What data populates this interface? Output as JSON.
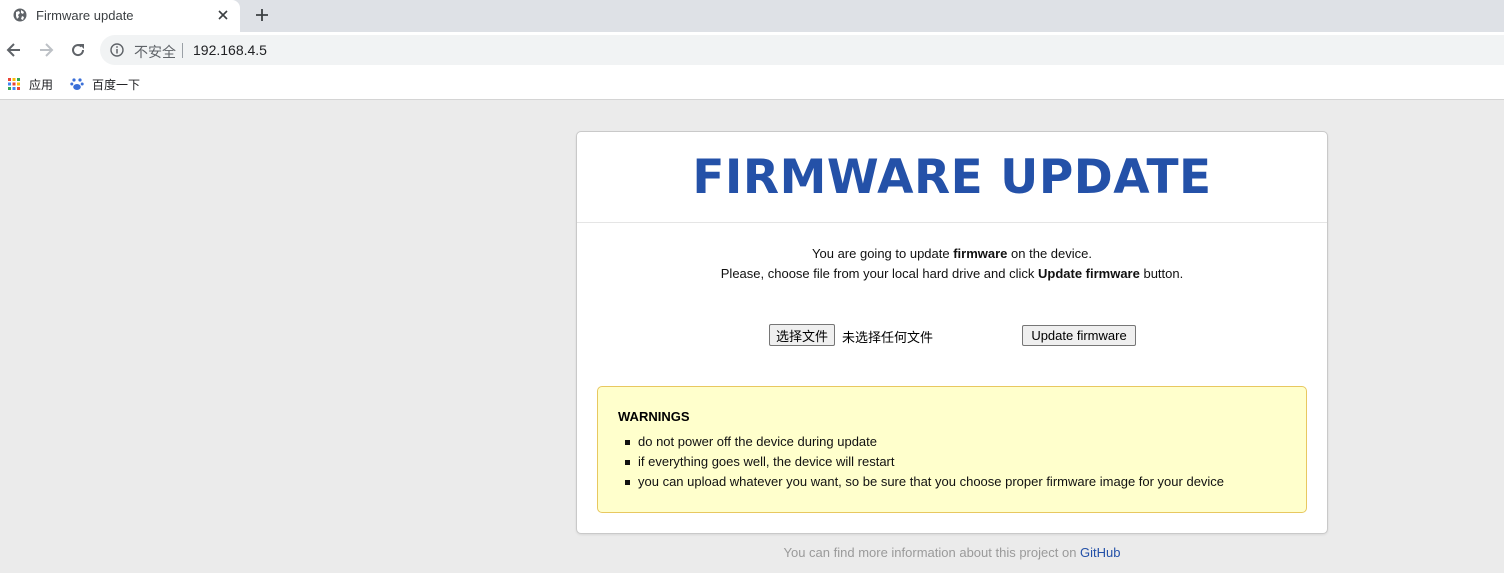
{
  "browser": {
    "tab": {
      "title": "Firmware update",
      "favicon": "globe-icon"
    },
    "nav": {
      "back": "back-arrow-icon",
      "forward": "forward-arrow-icon",
      "reload": "reload-icon"
    },
    "omnibox": {
      "security_label": "不安全",
      "url": "192.168.4.5"
    },
    "bookmarks": [
      {
        "label": "应用",
        "icon": "apps-grid-icon"
      },
      {
        "label": "百度一下",
        "icon": "baidu-paw-icon"
      }
    ]
  },
  "page": {
    "title": "FIRMWARE UPDATE",
    "intro": {
      "line1_pre": "You are going to update ",
      "line1_bold": "firmware",
      "line1_post": " on the device.",
      "line2_pre": "Please, choose file from your local hard drive and click ",
      "line2_bold": "Update firmware",
      "line2_post": " button."
    },
    "file_input": {
      "button_label": "选择文件",
      "status": "未选择任何文件"
    },
    "update_button": "Update firmware",
    "warnings": {
      "title": "WARNINGS",
      "items": [
        "do not power off the device during update",
        "if everything goes well, the device will restart",
        "you can upload whatever you want, so be sure that you choose proper firmware image for your device"
      ]
    },
    "footer": {
      "text": "You can find more information about this project on ",
      "link": "GitHub"
    }
  },
  "colors": {
    "title": "#2451a8",
    "warning_bg": "#ffffcc",
    "warning_border": "#e8c860",
    "page_bg": "#ebebeb"
  }
}
